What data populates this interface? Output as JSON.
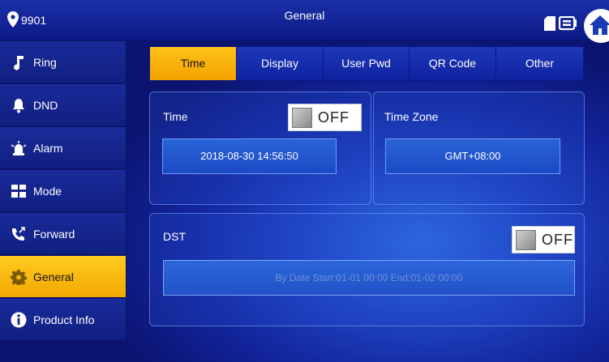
{
  "header": {
    "room_number": "9901",
    "title": "General"
  },
  "sidebar": {
    "items": [
      {
        "label": "Ring",
        "icon": "music-note-icon"
      },
      {
        "label": "DND",
        "icon": "bell-icon"
      },
      {
        "label": "Alarm",
        "icon": "alarm-siren-icon"
      },
      {
        "label": "Mode",
        "icon": "grid-icon"
      },
      {
        "label": "Forward",
        "icon": "phone-forward-icon"
      },
      {
        "label": "General",
        "icon": "gear-icon"
      },
      {
        "label": "Product Info",
        "icon": "info-icon"
      }
    ],
    "active": "General"
  },
  "tabs": {
    "items": [
      {
        "label": "Time"
      },
      {
        "label": "Display"
      },
      {
        "label": "User Pwd"
      },
      {
        "label": "QR Code"
      },
      {
        "label": "Other"
      }
    ],
    "active": "Time"
  },
  "time_panel": {
    "label": "Time",
    "toggle_state": "OFF",
    "datetime_value": "2018-08-30 14:56:50"
  },
  "timezone_panel": {
    "label": "Time Zone",
    "value": "GMT+08:00"
  },
  "dst_panel": {
    "label": "DST",
    "toggle_state": "OFF",
    "rule_text": "By Date Start:01-01 00:00  End:01-02 00:00"
  },
  "colors": {
    "accent_active": "#f4a800",
    "background_blue": "#12249a",
    "panel_border": "#82aaff"
  }
}
